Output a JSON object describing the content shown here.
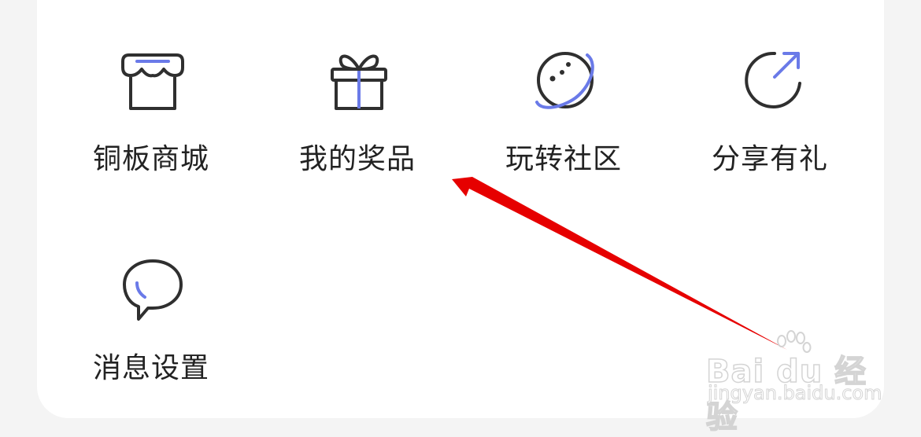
{
  "menu": {
    "items": [
      {
        "label": "铜板商城",
        "icon": "store-icon"
      },
      {
        "label": "我的奖品",
        "icon": "gift-icon"
      },
      {
        "label": "玩转社区",
        "icon": "planet-icon"
      },
      {
        "label": "分享有礼",
        "icon": "share-icon"
      },
      {
        "label": "消息设置",
        "icon": "chat-bubble-icon"
      }
    ]
  },
  "watermark": {
    "brand": "Bai du 经验",
    "url": "jingyan.baidu.com"
  },
  "colors": {
    "accent": "#6a7ae8",
    "icon_stroke": "#2f2f2f",
    "text": "#222222",
    "background": "#f4f4f4",
    "card": "#ffffff",
    "annotation_arrow": "#e60000"
  }
}
